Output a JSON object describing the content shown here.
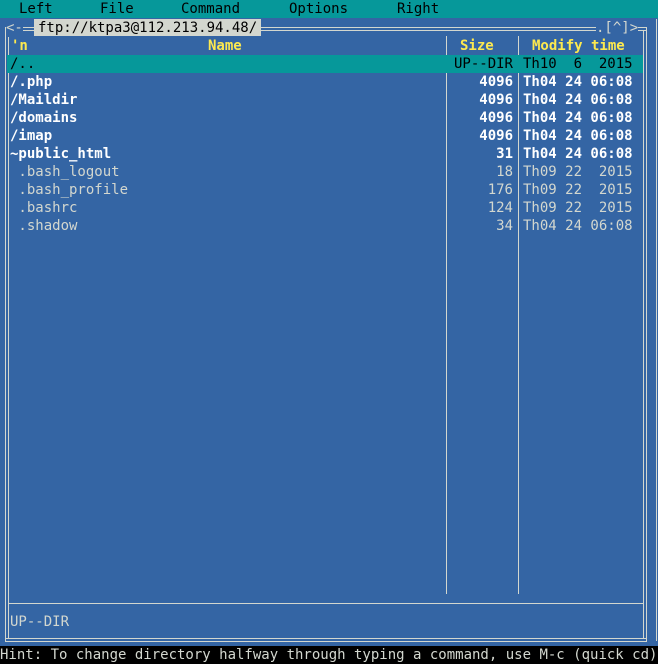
{
  "menu": {
    "left": "Left",
    "file": "File",
    "command": "Command",
    "options": "Options",
    "right": "Right"
  },
  "panel": {
    "path": "ftp://ktpa3@112.213.94.48/",
    "left_mark": "<-",
    "scroll_marks": ".[^]>",
    "headers": {
      "sort": "'n",
      "name": "Name",
      "size": "Size",
      "modify": "Modify time"
    },
    "rows": [
      {
        "name": "/..",
        "size": "UP--DIR",
        "time": "Th10  6  2015",
        "bold": false,
        "selected": true
      },
      {
        "name": "/.php",
        "size": "4096",
        "time": "Th04 24 06:08",
        "bold": true,
        "selected": false
      },
      {
        "name": "/Maildir",
        "size": "4096",
        "time": "Th04 24 06:08",
        "bold": true,
        "selected": false
      },
      {
        "name": "/domains",
        "size": "4096",
        "time": "Th04 24 06:08",
        "bold": true,
        "selected": false
      },
      {
        "name": "/imap",
        "size": "4096",
        "time": "Th04 24 06:08",
        "bold": true,
        "selected": false
      },
      {
        "name": "~public_html",
        "size": "31",
        "time": "Th04 24 06:08",
        "bold": true,
        "selected": false
      },
      {
        "name": " .bash_logout",
        "size": "18",
        "time": "Th09 22  2015",
        "bold": false,
        "selected": false
      },
      {
        "name": " .bash_profile",
        "size": "176",
        "time": "Th09 22  2015",
        "bold": false,
        "selected": false
      },
      {
        "name": " .bashrc",
        "size": "124",
        "time": "Th09 22  2015",
        "bold": false,
        "selected": false
      },
      {
        "name": " .shadow",
        "size": "34",
        "time": "Th04 24 06:08",
        "bold": false,
        "selected": false
      }
    ],
    "status": "UP--DIR"
  },
  "hint": "Hint: To change directory halfway through typing a command, use M-c (quick cd)."
}
